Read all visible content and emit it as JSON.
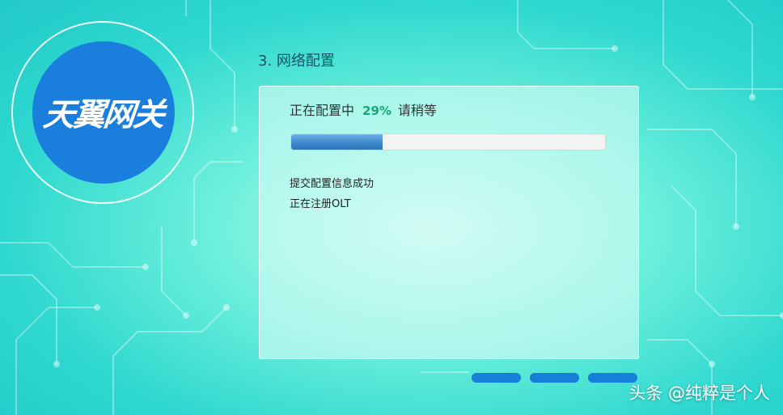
{
  "brand": {
    "logo_text": "天翼网关"
  },
  "step": {
    "title": "3. 网络配置"
  },
  "status": {
    "prefix": "正在配置中",
    "percent_text": "29%",
    "suffix": "请稍等"
  },
  "progress": {
    "value": 0.29
  },
  "log": [
    "提交配置信息成功",
    "正在注册OLT"
  ],
  "pager": {
    "dots": 3
  },
  "watermark": {
    "text": "头条 @纯粹是个人"
  },
  "colors": {
    "brand": "#1a7fdc",
    "accent": "#17a87a",
    "progress": "#3b86c8"
  }
}
